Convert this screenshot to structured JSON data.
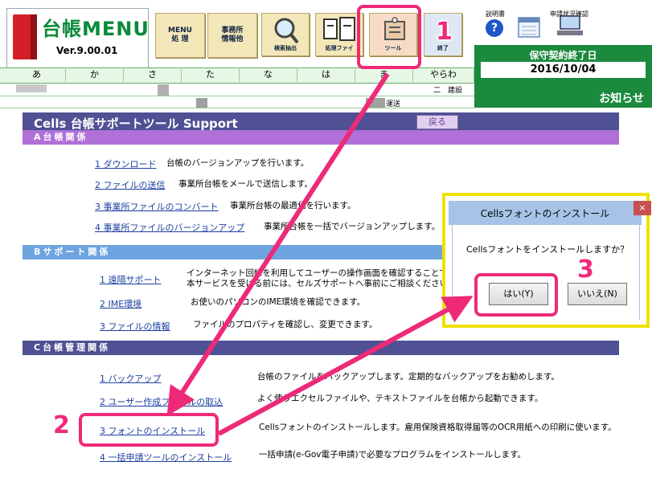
{
  "app": {
    "title": "台帳MENU",
    "version": "Ver.9.00.01"
  },
  "toolbar": {
    "menu_label": "MENU\n処 理",
    "office_label": "事務所\n情報他",
    "search_label": "検索抽出",
    "process_label": "処理ファイ",
    "tool_label": "ツール",
    "end_label": "終了"
  },
  "top_right": {
    "manual_label": "説明書",
    "status_label": "申請状況確認",
    "contract_title": "保守契約終了日",
    "contract_date": "2016/10/04",
    "notice": "お知らせ"
  },
  "kana_tabs": [
    "あ",
    "か",
    "さ",
    "た",
    "な",
    "は",
    "ま",
    "やらわ"
  ],
  "list_fragments": {
    "row1_right": "　二　建設",
    "row2_right": "運送"
  },
  "support": {
    "title": "Cells  台帳サポートツール     Support",
    "back_label": "戻る",
    "sections": [
      {
        "heading": "A台帳関係",
        "items": [
          {
            "link": "1 ダウンロード",
            "desc": "台帳のバージョンアップを行います。"
          },
          {
            "link": "2 ファイルの送信",
            "desc": "事業所台帳をメールで送信します。"
          },
          {
            "link": "3 事業所ファイルのコンバート",
            "desc": "事業所台帳の最適化を行います。"
          },
          {
            "link": "4 事業所ファイルのバージョンアップ",
            "desc": "事業所台帳を一括でバージョンアップします。"
          }
        ]
      },
      {
        "heading": "Bサポート関係",
        "items": [
          {
            "link": "1 遠隔サポート",
            "desc": "インターネット回線を利用してユーザーの操作画面を確認することで、\n本サービスを受ける前には、セルズサポートへ事前にご相談ください。"
          },
          {
            "link": "2 IME環境",
            "desc": "お使いのパソコンのIME環境を確認できます。"
          },
          {
            "link": "3 ファイルの情報",
            "desc": "ファイルのプロパティを確認し、変更できます。"
          }
        ]
      },
      {
        "heading": "C台帳管理関係",
        "items": [
          {
            "link": "1 バックアップ",
            "desc": "台帳のファイルをバックアップします。定期的なバックアップをお勧めします。"
          },
          {
            "link": "2 ユーザー作成ファイルの取込",
            "desc": "よく使うエクセルファイルや、テキストファイルを台帳から起動できます。"
          },
          {
            "link": "3 フォントのインストール",
            "desc": "Cellsフォントのインストールします。雇用保険資格取得届等のOCR用紙への印刷に使います。"
          },
          {
            "link": "4 一括申請ツールのインストール",
            "desc": "一括申請(e-Gov電子申請)で必要なプログラムをインストールします。"
          }
        ]
      }
    ]
  },
  "dialog": {
    "title": "Cellsフォントのインストール",
    "close": "×",
    "message": "Cellsフォントをインストールしますか？",
    "yes_label": "はい(Y)",
    "no_label": "いいえ(N)"
  },
  "callouts": {
    "step1": "1",
    "step2": "2",
    "step3": "3"
  },
  "colors": {
    "accent_pink": "#ee2a78",
    "header_navy": "#505094",
    "section_a": "#b070d8",
    "section_b": "#6ea4e0",
    "green": "#1b8a3d",
    "dialog_frame": "#f0e100"
  }
}
